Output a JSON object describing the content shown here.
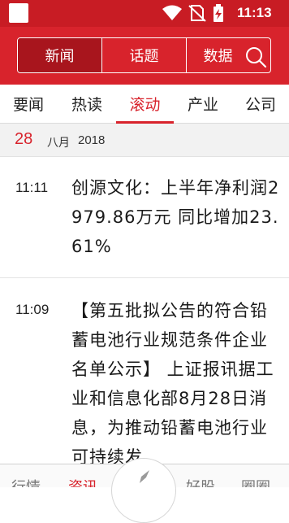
{
  "status_bar": {
    "time": "11:13",
    "icons": [
      "app-square-icon",
      "wifi-icon",
      "no-sim-icon",
      "battery-charging-icon"
    ]
  },
  "top_segments": {
    "items": [
      {
        "label": "新闻",
        "active": true
      },
      {
        "label": "话题",
        "active": false
      },
      {
        "label": "数据",
        "active": false
      }
    ],
    "search_icon": "search-icon"
  },
  "tabs": [
    {
      "label": "要闻",
      "active": false
    },
    {
      "label": "热读",
      "active": false
    },
    {
      "label": "滚动",
      "active": true
    },
    {
      "label": "产业",
      "active": false
    },
    {
      "label": "公司",
      "active": false
    }
  ],
  "date_header": {
    "day": "28",
    "month": "八月",
    "year": "2018"
  },
  "news": [
    {
      "time": "11:11",
      "title": "创源文化：上半年净利润2979.86万元 同比增加23.61%"
    },
    {
      "time": "11:09",
      "title": "【第五批拟公告的符合铅蓄电池行业规范条件企业名单公示】 上证报讯据工业和信息化部8月28日消息，为推动铅蓄电池行业可持续发"
    }
  ],
  "bottom_nav": [
    {
      "label": "行情",
      "active": false
    },
    {
      "label": "资讯",
      "active": true
    },
    {
      "label": "好股",
      "active": false
    },
    {
      "label": "圈圈",
      "active": false
    }
  ],
  "colors": {
    "brand_red": "#d8232c",
    "status_red": "#c81c24",
    "active_segment": "#a8151d"
  }
}
